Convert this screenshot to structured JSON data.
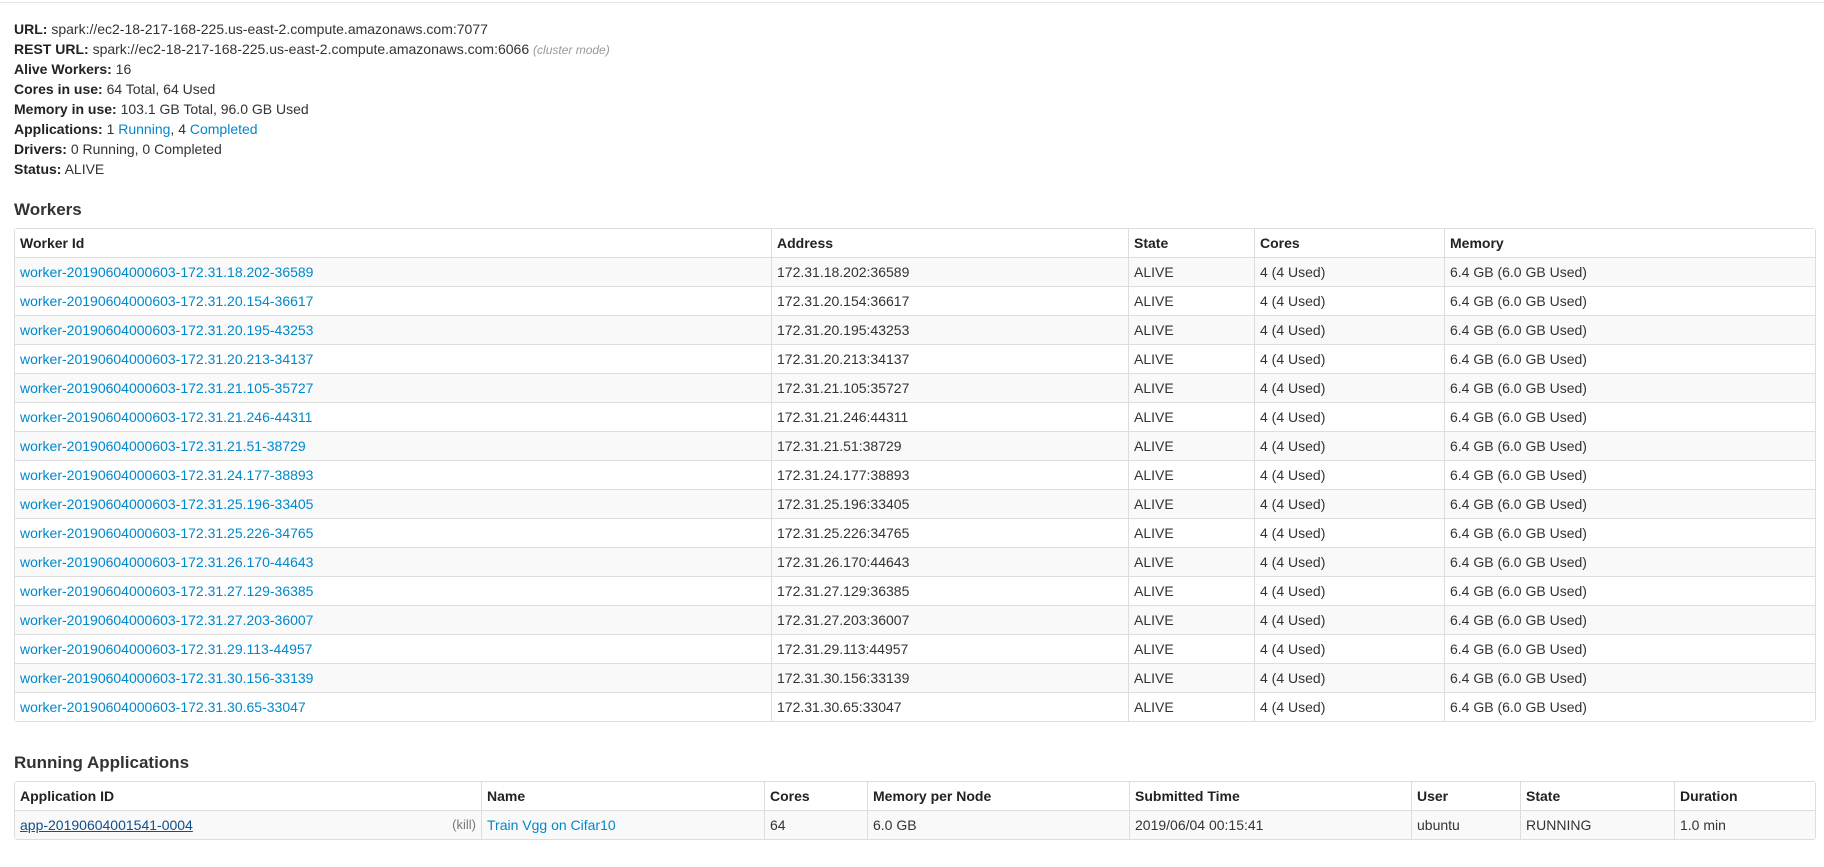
{
  "summary": {
    "url_label": "URL:",
    "url_value": "spark://ec2-18-217-168-225.us-east-2.compute.amazonaws.com:7077",
    "rest_url_label": "REST URL:",
    "rest_url_value": "spark://ec2-18-217-168-225.us-east-2.compute.amazonaws.com:6066",
    "rest_url_note": "(cluster mode)",
    "alive_workers_label": "Alive Workers:",
    "alive_workers_value": "16",
    "cores_label": "Cores in use:",
    "cores_value": "64 Total, 64 Used",
    "memory_label": "Memory in use:",
    "memory_value": "103.1 GB Total, 96.0 GB Used",
    "applications_label": "Applications:",
    "applications_running_count": "1",
    "applications_running_link": "Running",
    "applications_sep": ",",
    "applications_completed_count": "4",
    "applications_completed_link": "Completed",
    "drivers_label": "Drivers:",
    "drivers_value": "0 Running, 0 Completed",
    "status_label": "Status:",
    "status_value": "ALIVE"
  },
  "workers": {
    "title": "Workers",
    "columns": [
      "Worker Id",
      "Address",
      "State",
      "Cores",
      "Memory"
    ],
    "rows": [
      {
        "id": "worker-20190604000603-172.31.18.202-36589",
        "address": "172.31.18.202:36589",
        "state": "ALIVE",
        "cores": "4 (4 Used)",
        "memory": "6.4 GB (6.0 GB Used)"
      },
      {
        "id": "worker-20190604000603-172.31.20.154-36617",
        "address": "172.31.20.154:36617",
        "state": "ALIVE",
        "cores": "4 (4 Used)",
        "memory": "6.4 GB (6.0 GB Used)"
      },
      {
        "id": "worker-20190604000603-172.31.20.195-43253",
        "address": "172.31.20.195:43253",
        "state": "ALIVE",
        "cores": "4 (4 Used)",
        "memory": "6.4 GB (6.0 GB Used)"
      },
      {
        "id": "worker-20190604000603-172.31.20.213-34137",
        "address": "172.31.20.213:34137",
        "state": "ALIVE",
        "cores": "4 (4 Used)",
        "memory": "6.4 GB (6.0 GB Used)"
      },
      {
        "id": "worker-20190604000603-172.31.21.105-35727",
        "address": "172.31.21.105:35727",
        "state": "ALIVE",
        "cores": "4 (4 Used)",
        "memory": "6.4 GB (6.0 GB Used)"
      },
      {
        "id": "worker-20190604000603-172.31.21.246-44311",
        "address": "172.31.21.246:44311",
        "state": "ALIVE",
        "cores": "4 (4 Used)",
        "memory": "6.4 GB (6.0 GB Used)"
      },
      {
        "id": "worker-20190604000603-172.31.21.51-38729",
        "address": "172.31.21.51:38729",
        "state": "ALIVE",
        "cores": "4 (4 Used)",
        "memory": "6.4 GB (6.0 GB Used)"
      },
      {
        "id": "worker-20190604000603-172.31.24.177-38893",
        "address": "172.31.24.177:38893",
        "state": "ALIVE",
        "cores": "4 (4 Used)",
        "memory": "6.4 GB (6.0 GB Used)"
      },
      {
        "id": "worker-20190604000603-172.31.25.196-33405",
        "address": "172.31.25.196:33405",
        "state": "ALIVE",
        "cores": "4 (4 Used)",
        "memory": "6.4 GB (6.0 GB Used)"
      },
      {
        "id": "worker-20190604000603-172.31.25.226-34765",
        "address": "172.31.25.226:34765",
        "state": "ALIVE",
        "cores": "4 (4 Used)",
        "memory": "6.4 GB (6.0 GB Used)"
      },
      {
        "id": "worker-20190604000603-172.31.26.170-44643",
        "address": "172.31.26.170:44643",
        "state": "ALIVE",
        "cores": "4 (4 Used)",
        "memory": "6.4 GB (6.0 GB Used)"
      },
      {
        "id": "worker-20190604000603-172.31.27.129-36385",
        "address": "172.31.27.129:36385",
        "state": "ALIVE",
        "cores": "4 (4 Used)",
        "memory": "6.4 GB (6.0 GB Used)"
      },
      {
        "id": "worker-20190604000603-172.31.27.203-36007",
        "address": "172.31.27.203:36007",
        "state": "ALIVE",
        "cores": "4 (4 Used)",
        "memory": "6.4 GB (6.0 GB Used)"
      },
      {
        "id": "worker-20190604000603-172.31.29.113-44957",
        "address": "172.31.29.113:44957",
        "state": "ALIVE",
        "cores": "4 (4 Used)",
        "memory": "6.4 GB (6.0 GB Used)"
      },
      {
        "id": "worker-20190604000603-172.31.30.156-33139",
        "address": "172.31.30.156:33139",
        "state": "ALIVE",
        "cores": "4 (4 Used)",
        "memory": "6.4 GB (6.0 GB Used)"
      },
      {
        "id": "worker-20190604000603-172.31.30.65-33047",
        "address": "172.31.30.65:33047",
        "state": "ALIVE",
        "cores": "4 (4 Used)",
        "memory": "6.4 GB (6.0 GB Used)"
      }
    ]
  },
  "running_apps": {
    "title": "Running Applications",
    "columns": [
      "Application ID",
      "Name",
      "Cores",
      "Memory per Node",
      "Submitted Time",
      "User",
      "State",
      "Duration"
    ],
    "rows": [
      {
        "app_id": "app-20190604001541-0004",
        "kill_label": "(kill)",
        "name": "Train Vgg on Cifar10",
        "cores": "64",
        "memory_per_node": "6.0 GB",
        "submitted_time": "2019/06/04 00:15:41",
        "user": "ubuntu",
        "state": "RUNNING",
        "duration": "1.0 min"
      }
    ]
  },
  "colors": {
    "link": "#0088cc",
    "table_border": "#dddddd",
    "stripe": "#f9f9f9",
    "text": "#333333"
  }
}
